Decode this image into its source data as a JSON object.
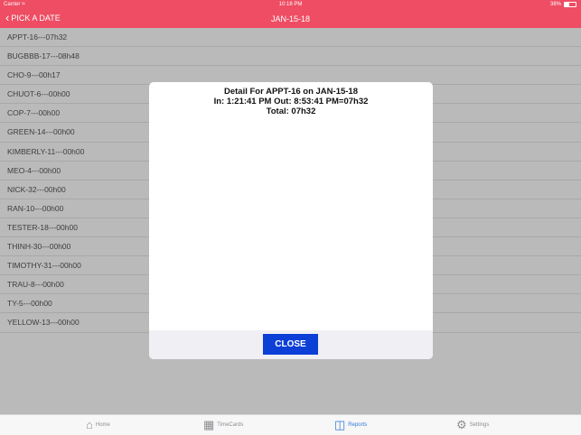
{
  "status_bar": {
    "carrier": "Carrier",
    "time": "10:18 PM",
    "battery": "38%"
  },
  "nav": {
    "back_label": "PICK A DATE",
    "title": "JAN-15-18"
  },
  "list": {
    "items": [
      "APPT-16---07h32",
      "BUGBBB-17---08h48",
      "CHO-9---00h17",
      "CHUOT-6---00h00",
      "COP-7---00h00",
      "GREEN-14---00h00",
      "KIMBERLY-11---00h00",
      "MEO-4---00h00",
      "NICK-32---00h00",
      "RAN-10---00h00",
      "TESTER-18---00h00",
      "THINH-30---00h00",
      "TIMOTHY-31---00h00",
      "TRAU-8---00h00",
      "TY-5---00h00",
      "YELLOW-13---00h00"
    ]
  },
  "modal": {
    "line1": "Detail For APPT-16 on JAN-15-18",
    "line2": "In: 1:21:41 PM  Out: 8:53:41 PM=07h32",
    "line3": "Total: 07h32",
    "close_label": "CLOSE"
  },
  "tabs": [
    {
      "label": "Home",
      "icon": "home-icon"
    },
    {
      "label": "TimeCards",
      "icon": "calendar-icon"
    },
    {
      "label": "Reports",
      "icon": "reports-icon",
      "active": true
    },
    {
      "label": "Settings",
      "icon": "gear-icon"
    }
  ],
  "colors": {
    "accent": "#ee4d63",
    "button": "#0b3fd6",
    "active_tab": "#2f7ad8"
  }
}
